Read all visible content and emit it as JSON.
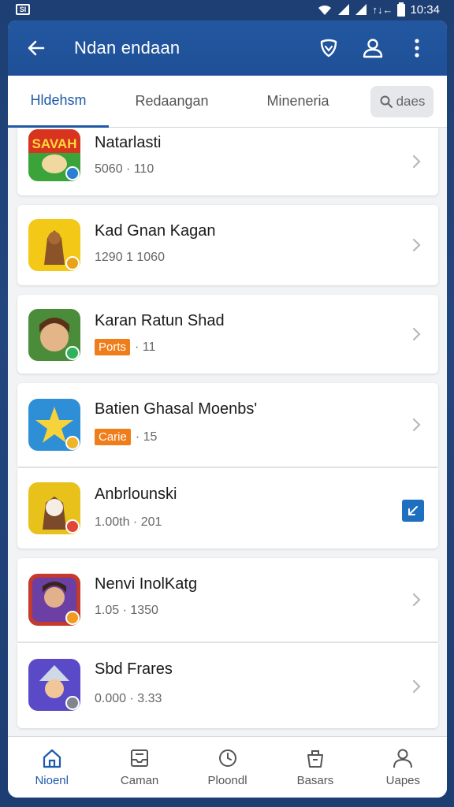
{
  "status_bar": {
    "sim_label": "SI",
    "network_label": "↑↓←",
    "time": "10:34"
  },
  "app_bar": {
    "title": "Ndan endaan",
    "back_icon": "arrow-left-icon",
    "actions": [
      "shield-heart-icon",
      "person-icon",
      "more-vert-icon"
    ]
  },
  "tabs": [
    {
      "label": "Hldehsm",
      "active": true
    },
    {
      "label": "Redaangan",
      "active": false
    },
    {
      "label": "Mineneria",
      "active": false
    }
  ],
  "search_chip": {
    "label": "daes",
    "icon": "search-icon"
  },
  "items": [
    {
      "name": "Natarlasti",
      "meta": "5060 · 110",
      "meta_style": "green",
      "badge": null,
      "trailing": "chevron",
      "thumb_text": "SAVAH"
    },
    {
      "name": "Kad Gnan Kagan",
      "meta": "1290 1 1060",
      "meta_style": "plain",
      "badge": null,
      "trailing": "chevron",
      "thumb_text": ""
    },
    {
      "name": "Karan Ratun Shad",
      "meta": "· 11",
      "meta_style": "red",
      "badge": "Ports",
      "trailing": "chevron",
      "thumb_text": ""
    },
    {
      "name": "Batien Ghasal Moenbs'",
      "meta": "· 15",
      "meta_style": "red",
      "badge": "Carie",
      "trailing": "chevron",
      "thumb_text": ""
    },
    {
      "name": "Anbrlounski",
      "meta": "1.00th · 201",
      "meta_style": "green",
      "badge": null,
      "trailing": "check",
      "thumb_text": ""
    },
    {
      "name": "Nenvi InolKatg",
      "meta": "1.05 · 1350",
      "meta_style": "plain",
      "badge": null,
      "trailing": "chevron",
      "thumb_text": ""
    },
    {
      "name": "Sbd Frares",
      "meta": "0.000 · 3.33",
      "meta_style": "plain",
      "badge": null,
      "trailing": "chevron",
      "thumb_text": ""
    }
  ],
  "bottom_nav": [
    {
      "label": "Nioenl",
      "icon": "home-icon",
      "active": true
    },
    {
      "label": "Caman",
      "icon": "inbox-icon",
      "active": false
    },
    {
      "label": "Ploondl",
      "icon": "timer-icon",
      "active": false
    },
    {
      "label": "Basars",
      "icon": "basket-icon",
      "active": false
    },
    {
      "label": "Uapes",
      "icon": "profile-icon",
      "active": false
    }
  ],
  "colors": {
    "accent": "#1e5aa8",
    "app_bar": "#2257a0",
    "badge": "#ef7d19",
    "meta_green": "#2f7d3a",
    "meta_red": "#c9352a"
  }
}
